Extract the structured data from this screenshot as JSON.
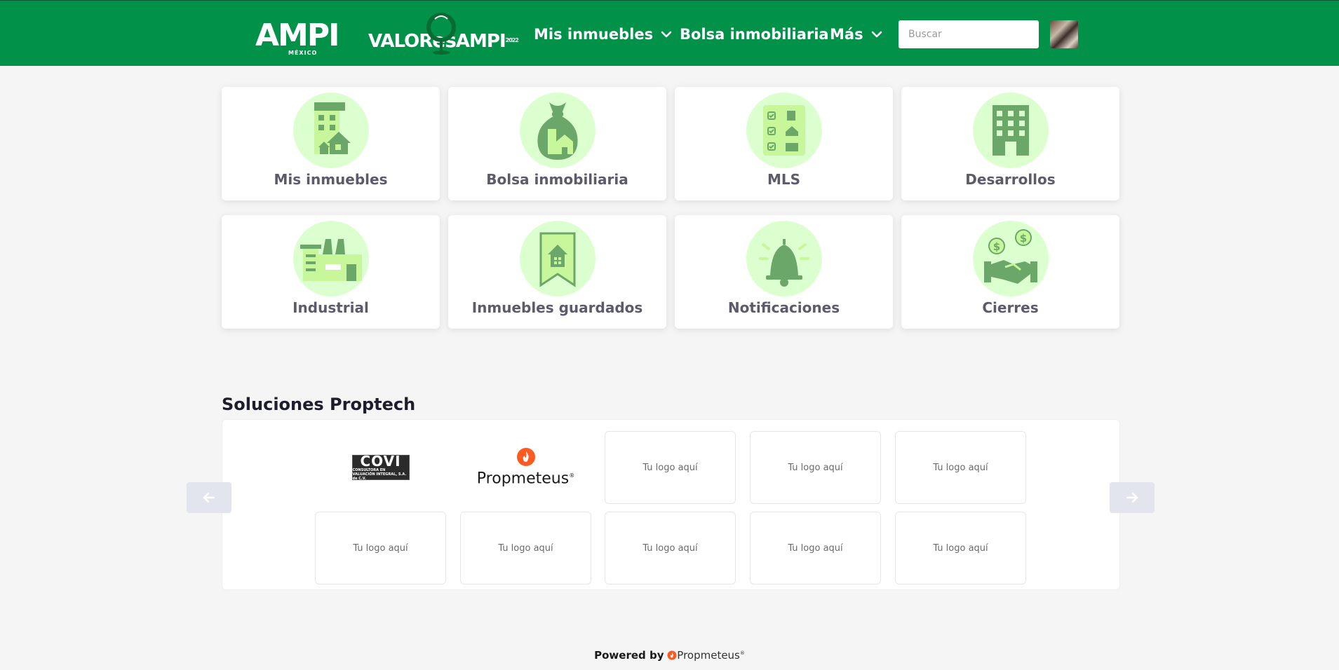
{
  "header": {
    "logo_ampi": "AMPI",
    "logo_ampi_sub": "MÉXICO",
    "logo_valor_a": "VALOR",
    "logo_valor_es": "es",
    "logo_valor_b": "AMPI",
    "logo_valor_sup": "2022",
    "nav": {
      "mis_inmuebles": "Mis inmuebles",
      "bolsa": "Bolsa inmobiliaria",
      "mas": "Más"
    },
    "search_placeholder": "Buscar"
  },
  "tiles": [
    {
      "label": "Mis inmuebles",
      "icon": "buildings-icon"
    },
    {
      "label": "Bolsa inmobiliaria",
      "icon": "money-bag-house-icon"
    },
    {
      "label": "MLS",
      "icon": "checklist-icon"
    },
    {
      "label": "Desarrollos",
      "icon": "office-building-icon"
    },
    {
      "label": "Industrial",
      "icon": "factory-icon"
    },
    {
      "label": "Inmuebles guardados",
      "icon": "bookmark-house-icon"
    },
    {
      "label": "Notificaciones",
      "icon": "bell-icon"
    },
    {
      "label": "Cierres",
      "icon": "handshake-icon"
    }
  ],
  "proptech": {
    "title": "Soluciones Proptech",
    "covi_big": "COVI",
    "covi_small": "CONSULTORA EN VALUACIÓN INTEGRAL, S.A. de C.V.",
    "propmeteus": "Propmeteus",
    "placeholder": "Tu logo aquí"
  },
  "footer": {
    "powered_by": "Powered by",
    "brand": "Propmeteus"
  },
  "colors": {
    "header_bg": "#019148",
    "icon_circle": "#dcffd0",
    "icon_dark": "#6aa769",
    "icon_light": "#c8f79b",
    "flame": "#ff5a1f"
  }
}
